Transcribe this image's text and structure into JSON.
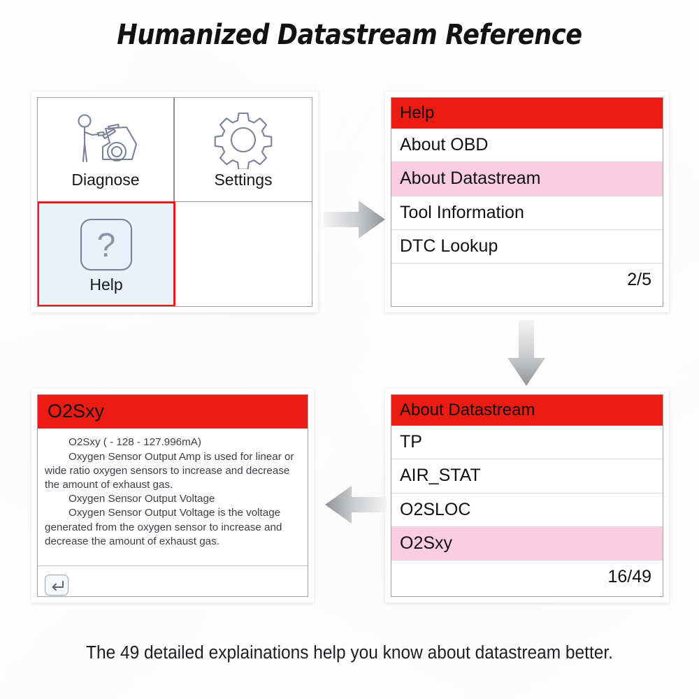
{
  "page": {
    "title": "Humanized Datastream Reference",
    "caption": "The 49 detailed explainations help you know about datastream better."
  },
  "colors": {
    "header_red": "#ed1c13",
    "highlight_pink": "#fbcde1",
    "selection_border_red": "#e21f13",
    "selection_fill_blue": "#e8f2fa",
    "icon_outline": "#7b8196",
    "arrow_gray": "#9b9ea2"
  },
  "home_screen": {
    "name": "home-menu",
    "cells": [
      {
        "label": "Diagnose",
        "icon": "mechanic-car-icon",
        "selected": false
      },
      {
        "label": "Settings",
        "icon": "gear-icon",
        "selected": false
      },
      {
        "label": "Help",
        "icon": "question-mark-icon",
        "selected": true
      },
      {
        "label": "",
        "icon": "",
        "selected": false
      }
    ]
  },
  "help_screen": {
    "header": "Help",
    "items": [
      {
        "label": "About OBD",
        "highlighted": false
      },
      {
        "label": "About Datastream",
        "highlighted": true
      },
      {
        "label": "Tool Information",
        "highlighted": false
      },
      {
        "label": "DTC Lookup",
        "highlighted": false
      }
    ],
    "pager": "2/5"
  },
  "about_datastream_screen": {
    "header": "About Datastream",
    "items": [
      {
        "label": "TP",
        "highlighted": false
      },
      {
        "label": "AIR_STAT",
        "highlighted": false
      },
      {
        "label": "O2SLOC",
        "highlighted": false
      },
      {
        "label": "O2Sxy",
        "highlighted": true
      }
    ],
    "pager": "16/49"
  },
  "detail_screen": {
    "header": "O2Sxy",
    "paragraphs": [
      "O2Sxy ( - 128 - 127.996mA)",
      "Oxygen Sensor Output Amp is used for linear or wide ratio oxygen sensors to increase and decrease the amount of exhaust gas.",
      "Oxygen Sensor Output Voltage",
      "Oxygen Sensor Output Voltage is the voltage generated from the oxygen sensor to increase and decrease the amount of exhaust gas."
    ],
    "back_button": "back-icon"
  },
  "arrows": [
    {
      "name": "arrow-home-to-help",
      "direction": "right"
    },
    {
      "name": "arrow-help-to-about",
      "direction": "down"
    },
    {
      "name": "arrow-about-to-detail",
      "direction": "left"
    }
  ]
}
